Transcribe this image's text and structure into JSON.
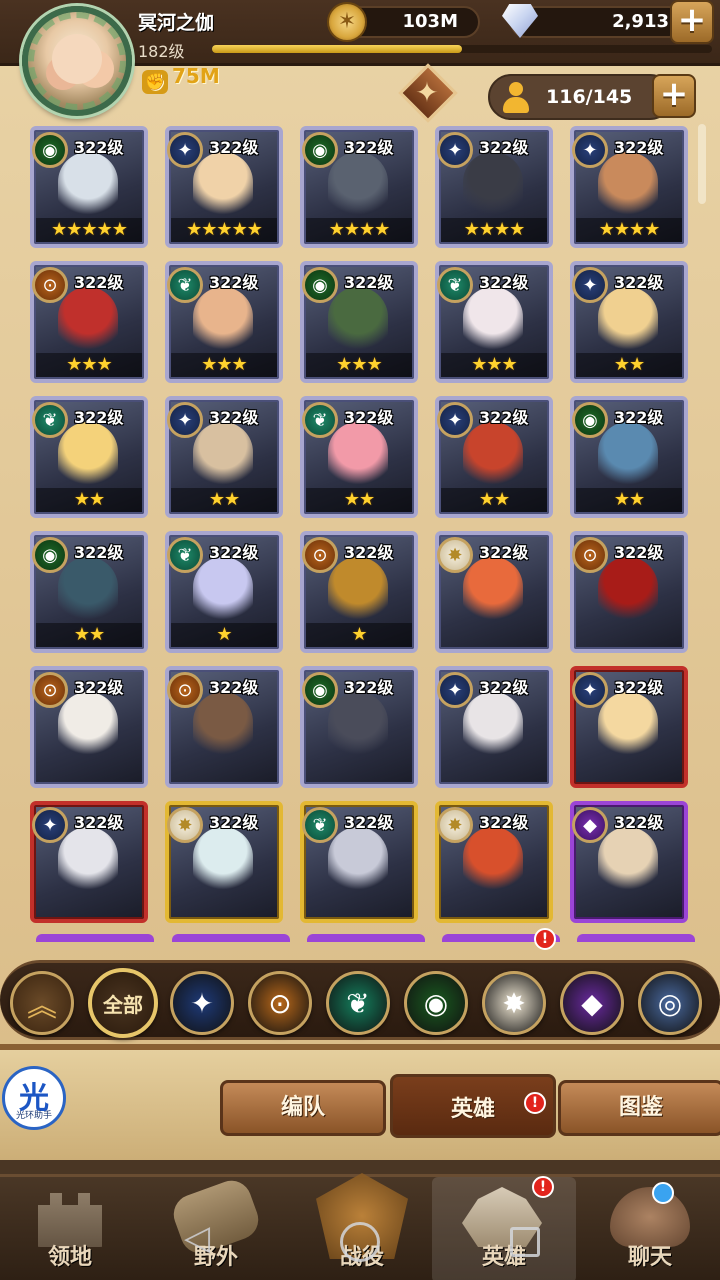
{
  "player": {
    "name": "冥河之伽",
    "level": "182级",
    "xp_fraction": 0.5,
    "power": "75M"
  },
  "currency": {
    "gold": "103M",
    "gems": "2,913"
  },
  "roster": {
    "count": "116/145"
  },
  "heroes": [
    {
      "level": "322级",
      "stars": "★★★★★",
      "faction": "grave",
      "frame": "silver",
      "portrait_color": "#d8e0e8"
    },
    {
      "level": "322级",
      "stars": "★★★★★",
      "faction": "light",
      "frame": "silver",
      "portrait_color": "#f0d2a8"
    },
    {
      "level": "322级",
      "stars": "★★★★",
      "faction": "grave",
      "frame": "silver",
      "portrait_color": "#5a6270"
    },
    {
      "level": "322级",
      "stars": "★★★★",
      "faction": "light",
      "frame": "silver",
      "portrait_color": "#3a3c46"
    },
    {
      "level": "322级",
      "stars": "★★★★",
      "faction": "light",
      "frame": "silver",
      "portrait_color": "#c98a5c"
    },
    {
      "level": "322级",
      "stars": "★★★",
      "faction": "maul",
      "frame": "silver",
      "portrait_color": "#c0302c"
    },
    {
      "level": "322级",
      "stars": "★★★",
      "faction": "wild",
      "frame": "silver",
      "portrait_color": "#e8b48c"
    },
    {
      "level": "322级",
      "stars": "★★★",
      "faction": "grave",
      "frame": "silver",
      "portrait_color": "#4a6a40"
    },
    {
      "level": "322级",
      "stars": "★★★",
      "faction": "wild",
      "frame": "silver",
      "portrait_color": "#f0e6ea"
    },
    {
      "level": "322级",
      "stars": "★★",
      "faction": "light",
      "frame": "silver",
      "portrait_color": "#f0d090"
    },
    {
      "level": "322级",
      "stars": "★★",
      "faction": "wild",
      "frame": "silver",
      "portrait_color": "#f4d27a"
    },
    {
      "level": "322级",
      "stars": "★★",
      "faction": "light",
      "frame": "silver",
      "portrait_color": "#d8c0a0"
    },
    {
      "level": "322级",
      "stars": "★★",
      "faction": "wild",
      "frame": "silver",
      "portrait_color": "#f29aa8"
    },
    {
      "level": "322级",
      "stars": "★★",
      "faction": "light",
      "frame": "silver",
      "portrait_color": "#c8442c"
    },
    {
      "level": "322级",
      "stars": "★★",
      "faction": "grave",
      "frame": "silver",
      "portrait_color": "#5a8ab0"
    },
    {
      "level": "322级",
      "stars": "★★",
      "faction": "grave",
      "frame": "silver",
      "portrait_color": "#3a5a6a"
    },
    {
      "level": "322级",
      "stars": "★",
      "faction": "wild",
      "frame": "silver",
      "portrait_color": "#c8c8f0"
    },
    {
      "level": "322级",
      "stars": "★",
      "faction": "maul",
      "frame": "silver",
      "portrait_color": "#c08a2c"
    },
    {
      "level": "322级",
      "stars": "",
      "faction": "celes",
      "frame": "silver",
      "portrait_color": "#e86a3c"
    },
    {
      "level": "322级",
      "stars": "",
      "faction": "maul",
      "frame": "silver",
      "portrait_color": "#a81c18"
    },
    {
      "level": "322级",
      "stars": "",
      "faction": "maul",
      "frame": "silver",
      "portrait_color": "#f0ece6"
    },
    {
      "level": "322级",
      "stars": "",
      "faction": "maul",
      "frame": "silver",
      "portrait_color": "#7a5a44"
    },
    {
      "level": "322级",
      "stars": "",
      "faction": "grave",
      "frame": "silver",
      "portrait_color": "#4a4c5a"
    },
    {
      "level": "322级",
      "stars": "",
      "faction": "light",
      "frame": "silver",
      "portrait_color": "#e8e4e6"
    },
    {
      "level": "322级",
      "stars": "",
      "faction": "light",
      "frame": "red",
      "portrait_color": "#f4d8a0"
    },
    {
      "level": "322级",
      "stars": "",
      "faction": "light",
      "frame": "red",
      "portrait_color": "#e4e4ea"
    },
    {
      "level": "322级",
      "stars": "",
      "faction": "celes",
      "frame": "gold",
      "portrait_color": "#dcecee"
    },
    {
      "level": "322级",
      "stars": "",
      "faction": "wild",
      "frame": "gold",
      "portrait_color": "#c8cad8"
    },
    {
      "level": "322级",
      "stars": "",
      "faction": "celes",
      "frame": "gold",
      "portrait_color": "#d8502c"
    },
    {
      "level": "322级",
      "stars": "",
      "faction": "hypo",
      "frame": "purple",
      "portrait_color": "#e6d2b4"
    }
  ],
  "filters": {
    "all_label": "全部",
    "items": [
      {
        "name": "light",
        "icon": "✦",
        "color": "#1e3a78"
      },
      {
        "name": "maul",
        "icon": "⊙",
        "color": "#b8681a"
      },
      {
        "name": "wild",
        "icon": "❦",
        "color": "#14805e"
      },
      {
        "name": "grave",
        "icon": "◉",
        "color": "#1a5a20"
      },
      {
        "name": "celes",
        "icon": "✸",
        "color": "#efe6d2"
      },
      {
        "name": "hypo",
        "icon": "◆",
        "color": "#6a2aa0"
      },
      {
        "name": "dimensional",
        "icon": "◎",
        "color": "#4a6aa0"
      }
    ]
  },
  "tabs": {
    "team": "编队",
    "heroes": "英雄",
    "codex": "图鉴"
  },
  "helper": {
    "char": "光",
    "caption": "光环助手"
  },
  "nav": {
    "home": "领地",
    "outside": "野外",
    "battle": "战役",
    "heroes": "英雄",
    "chat": "聊天"
  },
  "badges": {
    "alert": "!"
  }
}
